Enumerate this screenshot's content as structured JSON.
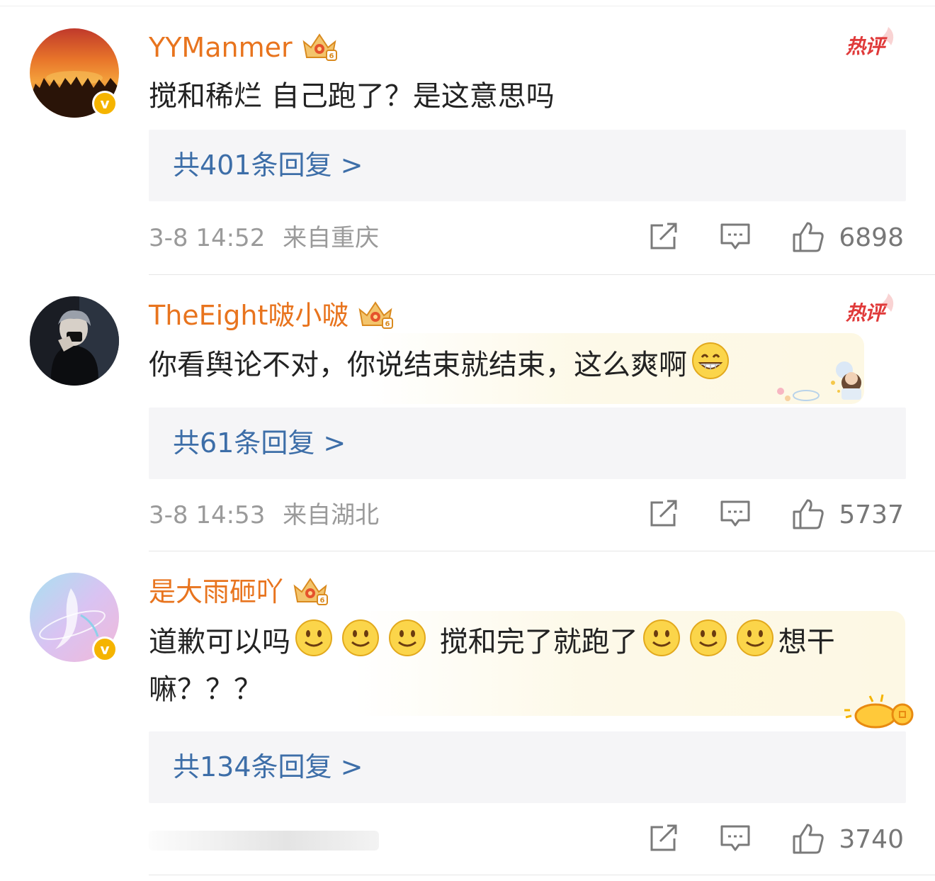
{
  "comments": [
    {
      "username": "YYManmer",
      "verified": true,
      "hot_label": "热评",
      "text": "搅和稀烂 自己跑了？是这意思吗",
      "replies_label": "共401条回复 >",
      "time": "3-8 14:52",
      "location": "来自重庆",
      "likes": "6898"
    },
    {
      "username": "TheEight啵小啵",
      "verified": false,
      "hot_label": "热评",
      "text_before": "你看舆论不对，你说结束就结束，这么爽啊",
      "text_emoji": "grinning-face-emoji",
      "replies_label": "共61条回复 >",
      "time": "3-8 14:53",
      "location": "来自湖北",
      "likes": "5737"
    },
    {
      "username": "是大雨砸吖",
      "verified": true,
      "text_line1_a": "道歉可以吗",
      "text_line1_b": " 搅和完了就跑了",
      "text_line1_c": "想干",
      "text_line2": "嘛？？？",
      "text_emoji": "slight-smile-emoji",
      "replies_label": "共134条回复 >",
      "likes": "3740"
    }
  ],
  "colors": {
    "username": "#e8741e",
    "reply_link": "#3d6ea8",
    "meta_text": "#9a9a9a",
    "hot_badge": "#e03a3a",
    "verified_badge": "#f5b400"
  }
}
